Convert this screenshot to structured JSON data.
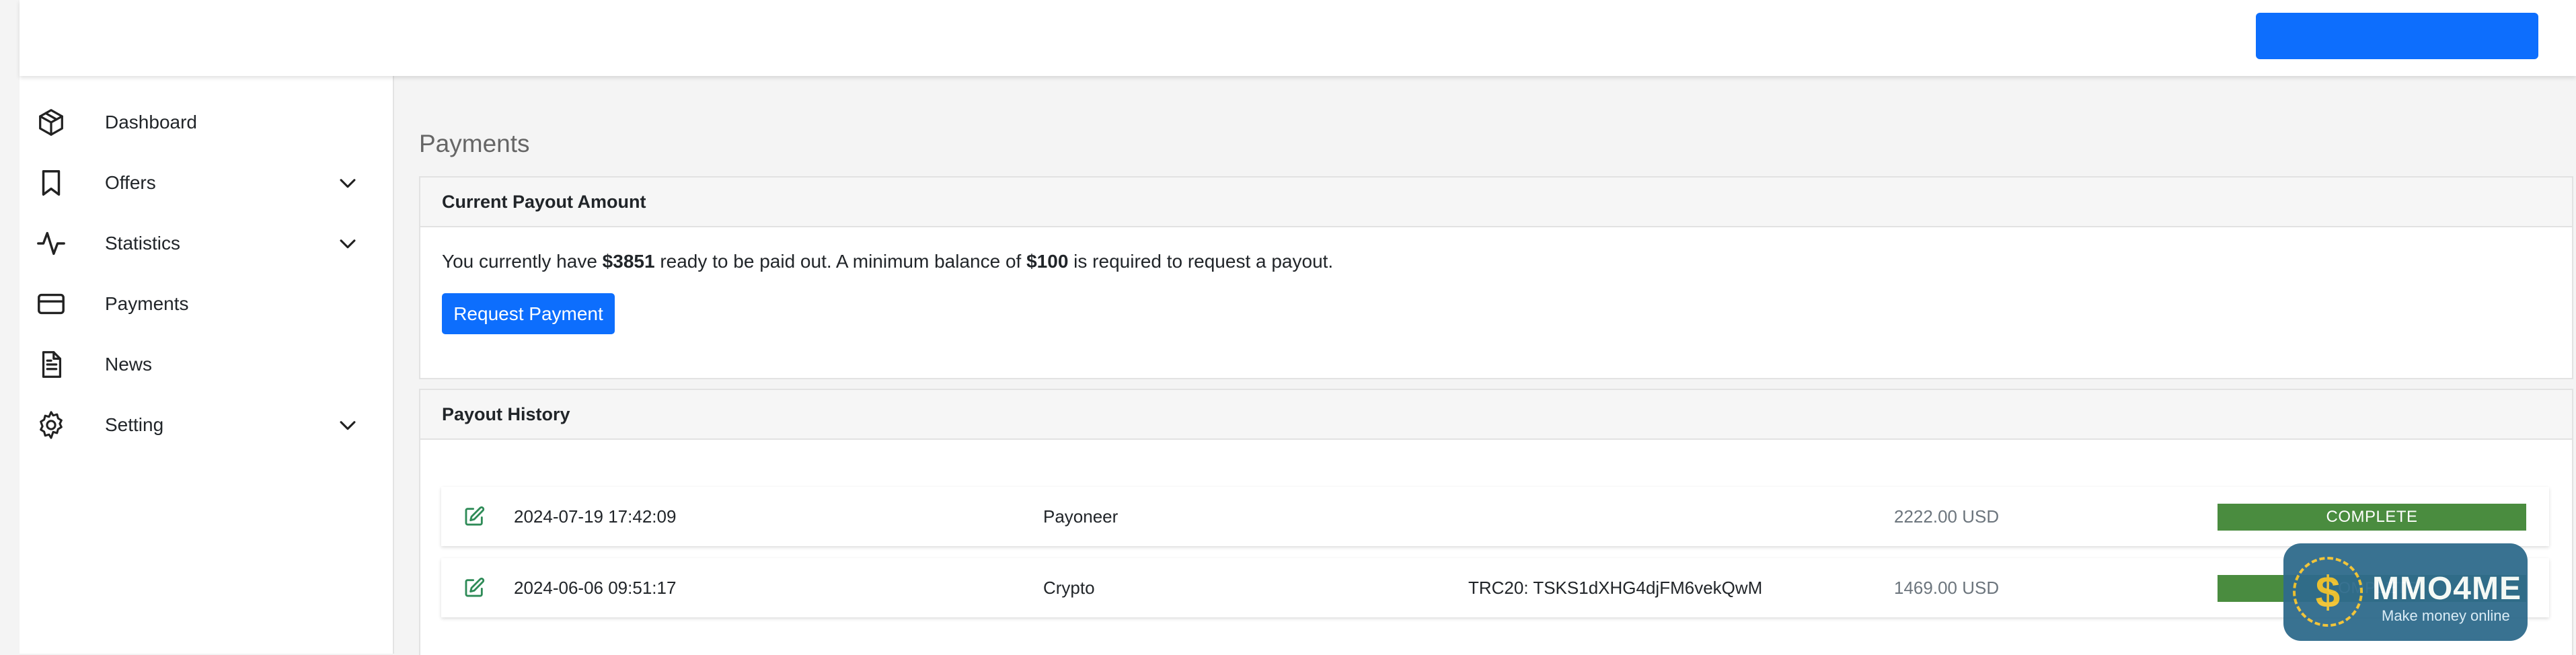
{
  "sidebar": {
    "items": [
      {
        "label": "Dashboard",
        "icon": "cube-icon",
        "has_submenu": false
      },
      {
        "label": "Offers",
        "icon": "bookmark-icon",
        "has_submenu": true
      },
      {
        "label": "Statistics",
        "icon": "activity-icon",
        "has_submenu": true
      },
      {
        "label": "Payments",
        "icon": "credit-card-icon",
        "has_submenu": false
      },
      {
        "label": "News",
        "icon": "document-icon",
        "has_submenu": false
      },
      {
        "label": "Setting",
        "icon": "gear-icon",
        "has_submenu": true
      }
    ]
  },
  "page": {
    "title": "Payments"
  },
  "current_payout": {
    "header": "Current Payout Amount",
    "text_prefix": "You currently have ",
    "amount": "$3851",
    "text_middle": " ready to be paid out. A minimum balance of ",
    "minimum": "$100",
    "text_suffix": " is required to request a payout.",
    "button_label": "Request Payment"
  },
  "payout_history": {
    "header": "Payout History",
    "rows": [
      {
        "date": "2024-07-19 17:42:09",
        "method": "Payoneer",
        "account": "",
        "amount": "2222.00 USD",
        "status": "COMPLETE"
      },
      {
        "date": "2024-06-06 09:51:17",
        "method": "Crypto",
        "account": "TRC20: TSKS1dXHG4djFM6vekQwM",
        "amount": "1469.00 USD",
        "status": "COMPLETE"
      }
    ]
  },
  "watermark": {
    "brand": "MMO4ME",
    "tagline": "Make money online",
    "symbol": "$"
  },
  "colors": {
    "primary": "#0d6efd",
    "success": "#4a8c3f",
    "watermark_bg": "#2f6b8c"
  }
}
